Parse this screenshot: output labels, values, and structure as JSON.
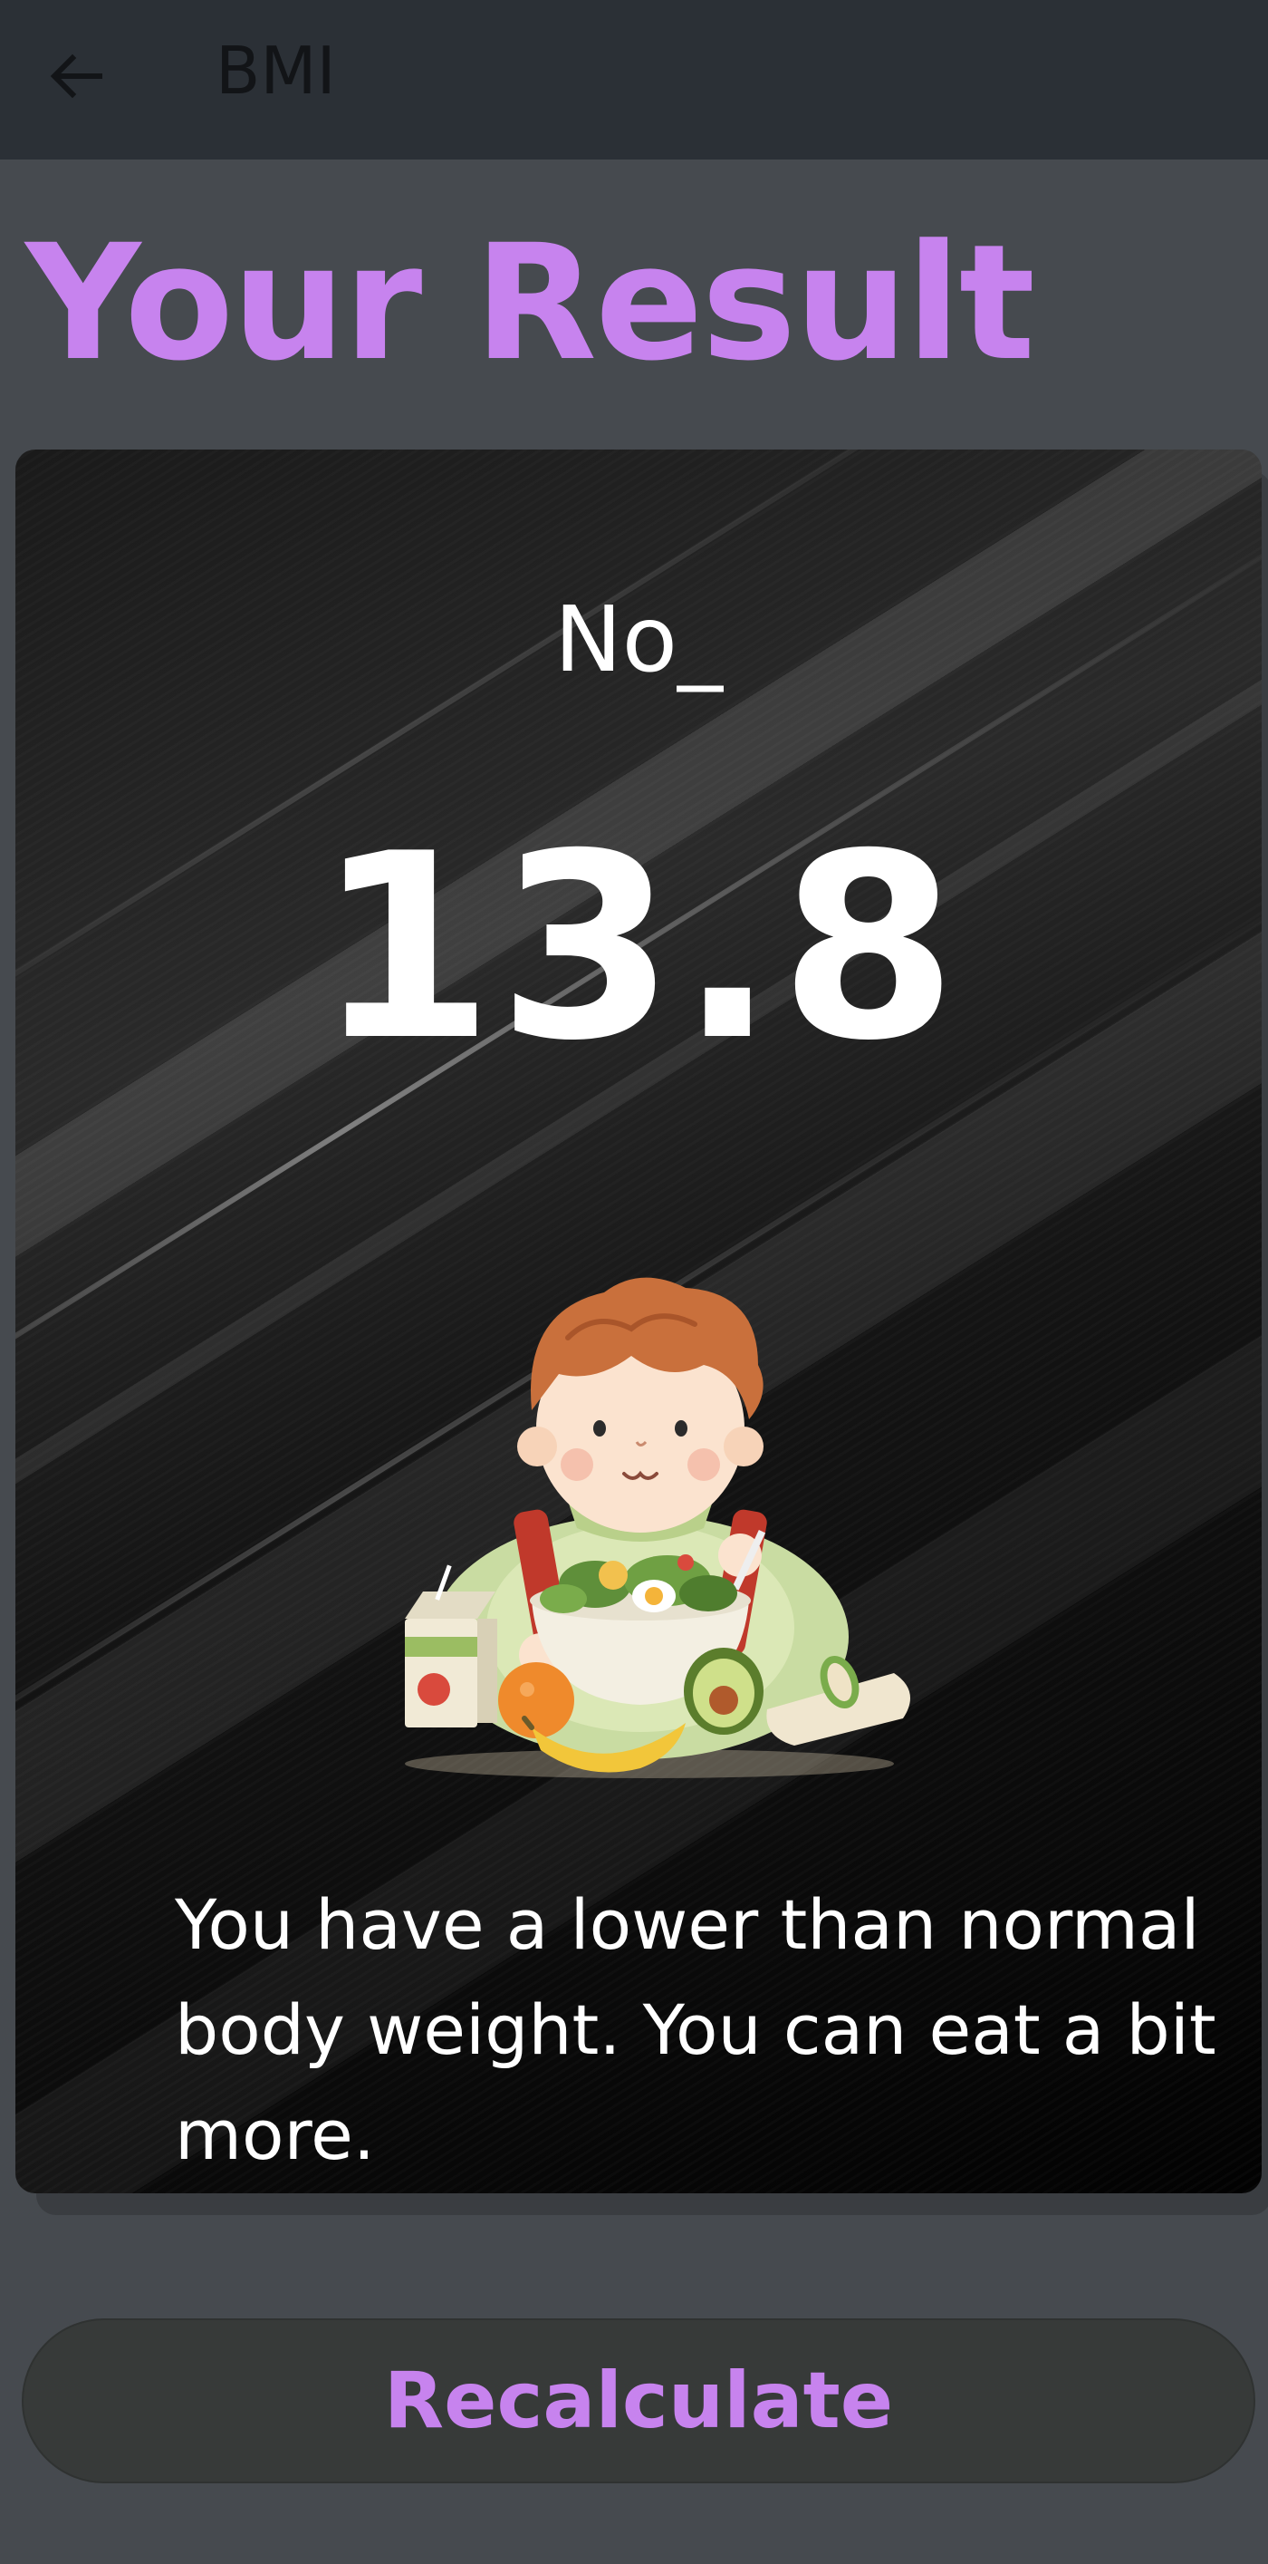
{
  "app_bar": {
    "title": "BMI",
    "back_icon": "arrow-left-icon"
  },
  "page": {
    "title": "Your Result"
  },
  "result": {
    "status": "No_",
    "bmi": "13.8",
    "message": "You have a lower than normal body weight. You can eat a bit more.",
    "illustration": "child-eating-salad-illustration"
  },
  "actions": {
    "recalculate_label": "Recalculate"
  },
  "colors": {
    "accent": "#c783ee",
    "app_bar_bg": "#2b3036",
    "page_bg": "#464a4f",
    "card_bg": "#0a0a0a",
    "button_bg": "#373a39"
  }
}
